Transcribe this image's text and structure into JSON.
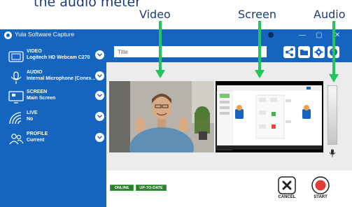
{
  "annotation": {
    "title": "the audio meter",
    "labels": {
      "video": "Video",
      "screen": "Screen",
      "audio": "Audio"
    },
    "arrow_color": "#22c55e"
  },
  "window": {
    "title": "Yula Software Capture",
    "controls": [
      "—",
      "▢",
      "✕"
    ]
  },
  "sidebar": {
    "items": [
      {
        "label": "VIDEO",
        "value": "Logitech HD Webcam C270",
        "icon": "webcam-icon"
      },
      {
        "label": "AUDIO",
        "value": "Internal Microphone (Conex...",
        "icon": "microphone-icon"
      },
      {
        "label": "SCREEN",
        "value": "Main Screen",
        "icon": "monitor-icon"
      },
      {
        "label": "LIVE",
        "value": "No",
        "icon": "broadcast-icon"
      },
      {
        "label": "PROFILE",
        "value": "Current",
        "icon": "users-icon"
      }
    ]
  },
  "toolbar": {
    "title_placeholder": "Title",
    "buttons": [
      "share-icon",
      "folder-icon",
      "gear-icon",
      "help-icon"
    ]
  },
  "status": {
    "online": "ONLINE",
    "up_to_date": "UP-TO-DATE"
  },
  "actions": {
    "cancel": "CANCEL",
    "start": "START"
  },
  "colors": {
    "brand_blue": "#1565c0",
    "badge_green": "#2e7d32",
    "record_red": "#e53935"
  }
}
